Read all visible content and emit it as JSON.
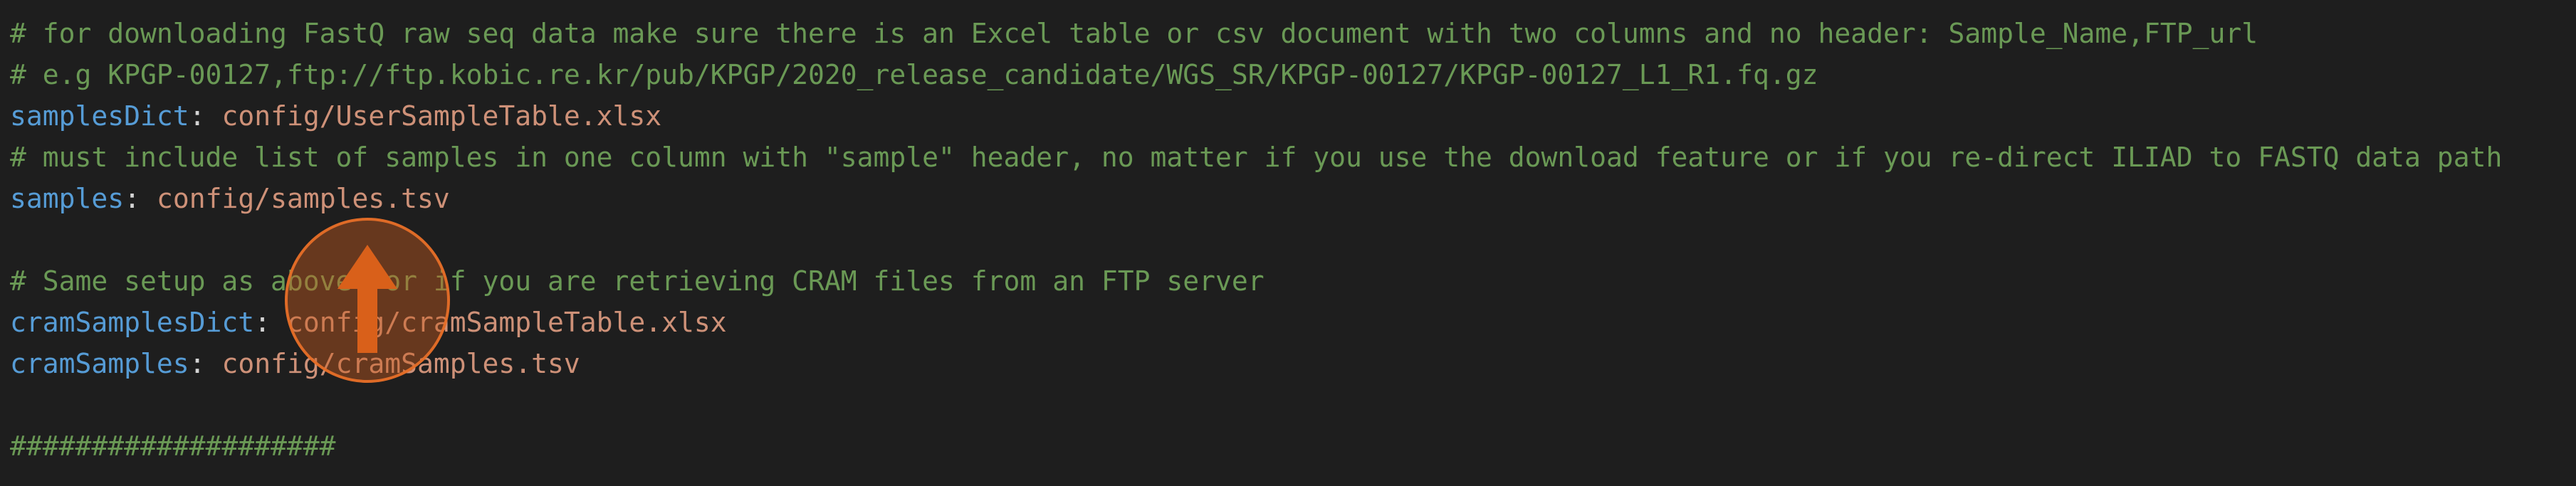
{
  "editor": {
    "lines": [
      {
        "type": "comment",
        "text": "# for downloading FastQ raw seq data make sure there is an Excel table or csv document with two columns and no header: Sample_Name,FTP_url"
      },
      {
        "type": "comment",
        "text": "# e.g KPGP-00127,ftp://ftp.kobic.re.kr/pub/KPGP/2020_release_candidate/WGS_SR/KPGP-00127/KPGP-00127_L1_R1.fq.gz"
      },
      {
        "type": "kv",
        "key": "samplesDict",
        "value": "config/UserSampleTable.xlsx"
      },
      {
        "type": "comment",
        "text": "# must include list of samples in one column with \"sample\" header, no matter if you use the download feature or if you re-direct ILIAD to FASTQ data path"
      },
      {
        "type": "kv",
        "key": "samples",
        "value": "config/samples.tsv"
      },
      {
        "type": "comment",
        "text": "# Same setup as above for if you are retrieving CRAM files from an FTP server"
      },
      {
        "type": "kv",
        "key": "cramSamplesDict",
        "value": "config/cramSampleTable.xlsx"
      },
      {
        "type": "kv",
        "key": "cramSamples",
        "value": "config/cramSamples.tsv"
      },
      {
        "type": "comment",
        "text": "####################"
      }
    ],
    "separator": ":"
  },
  "colors": {
    "background": "#1e1e1e",
    "comment": "#6a9955",
    "key": "#569cd6",
    "value": "#ce9178",
    "cursor_marker": "#e0661e"
  },
  "icons": {
    "cursor_marker": "up-arrow-icon"
  }
}
